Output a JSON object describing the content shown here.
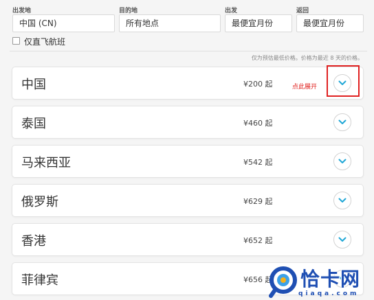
{
  "search": {
    "origin_label": "出发地",
    "origin_value": "中国 (CN)",
    "destination_label": "目的地",
    "destination_value": "所有地点",
    "depart_label": "出发",
    "depart_value": "最便宜月份",
    "return_label": "返回",
    "return_value": "最便宜月份",
    "direct_only_label": "仅直飞航班",
    "note": "仅为预估最低价格。价格为最近 8 天的价格。"
  },
  "destinations": [
    {
      "name": "中国",
      "price": "¥200 起"
    },
    {
      "name": "泰国",
      "price": "¥460 起"
    },
    {
      "name": "马来西亚",
      "price": "¥542 起"
    },
    {
      "name": "俄罗斯",
      "price": "¥629 起"
    },
    {
      "name": "香港",
      "price": "¥652 起"
    },
    {
      "name": "菲律宾",
      "price": "¥656 起"
    }
  ],
  "annotation": {
    "hint": "点此展开"
  },
  "watermark": {
    "brand": "恰卡网",
    "url": "qiaqa.com"
  },
  "colors": {
    "accent": "#1ea6d6",
    "annotation": "#e02020",
    "watermark": "#1f4fb3"
  },
  "icons": {
    "expand": "chevron-down-icon",
    "logo": "magnifier-logo-icon"
  }
}
